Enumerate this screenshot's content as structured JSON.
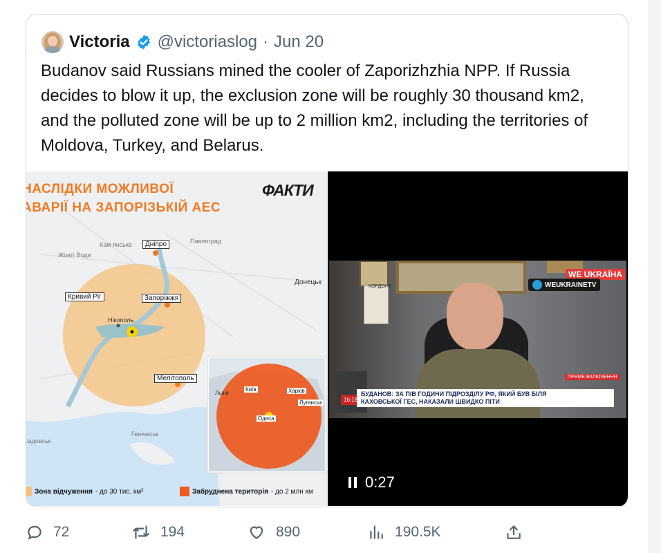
{
  "tweet": {
    "author": {
      "name": "Victoria",
      "handle": "@victoriaslog",
      "date": "Jun 20"
    },
    "separator": "·",
    "text": "Budanov said Russians mined the cooler of Zaporizhzhia NPP. If Russia decides to blow it up, the exclusion zone will be roughly 30 thousand km2, and the polluted zone will be up to 2 million km2, including the territories of Moldova, Turkey, and Belarus."
  },
  "map_image": {
    "title_line1": "НАСЛІДКИ МОЖЛИВОЇ",
    "title_line2": "АВАРІЇ НА ЗАПОРІЗЬКІЙ АЕС",
    "brand": "ФАКТИ",
    "cities": {
      "dnipro": "Дніпро",
      "kryvyi_rih": "Кривий Ріг",
      "zaporizhzhia": "Запоріжжя",
      "nikopol": "Нікополь",
      "melitopol": "Мелітополь",
      "kamianske": "Кам янське",
      "pavlohrad": "Павлоград",
      "zhovti_vody": "Жовті Води",
      "donetsk": "Донецьк",
      "henichesk": "Генічеськ",
      "sadovsk": "садовськ"
    },
    "inset_cities": {
      "kyiv": "Київ",
      "kharkiv": "Харків",
      "lviv": "Львів",
      "luhansk": "Луганськ",
      "odesa": "Одеса"
    },
    "legend": {
      "exclusion": "Зона відчуження",
      "exclusion_value": "- до 30 тис. км²",
      "polluted": "Забруднена територія",
      "polluted_value": "- до 2 млн км"
    },
    "colors": {
      "exclusion": "#f6c07a",
      "polluted": "#ee5a1f",
      "title": "#f07a22"
    }
  },
  "video": {
    "channel_tag": "WEUKRAINETV",
    "logo": "WE UKRAЇНА",
    "live_tag": "ПРЯМЕ ВКЛЮЧЕННЯ",
    "time_badge": "16:18",
    "headline_line1": "БУДАНОВ: ЗА ПІВ ГОДИНИ ПІДРОЗДІЛУ РФ, ЯКИЙ БУВ БІЛЯ",
    "headline_line2": "КАХОВСЬКОЇ ГЕС, НАКАЗАЛИ ШВИДКО ПІТИ",
    "duration": "0:27",
    "bg_text": "КОРДОНУ"
  },
  "metrics": {
    "replies": "72",
    "retweets": "194",
    "likes": "890",
    "views": "190.5K"
  }
}
